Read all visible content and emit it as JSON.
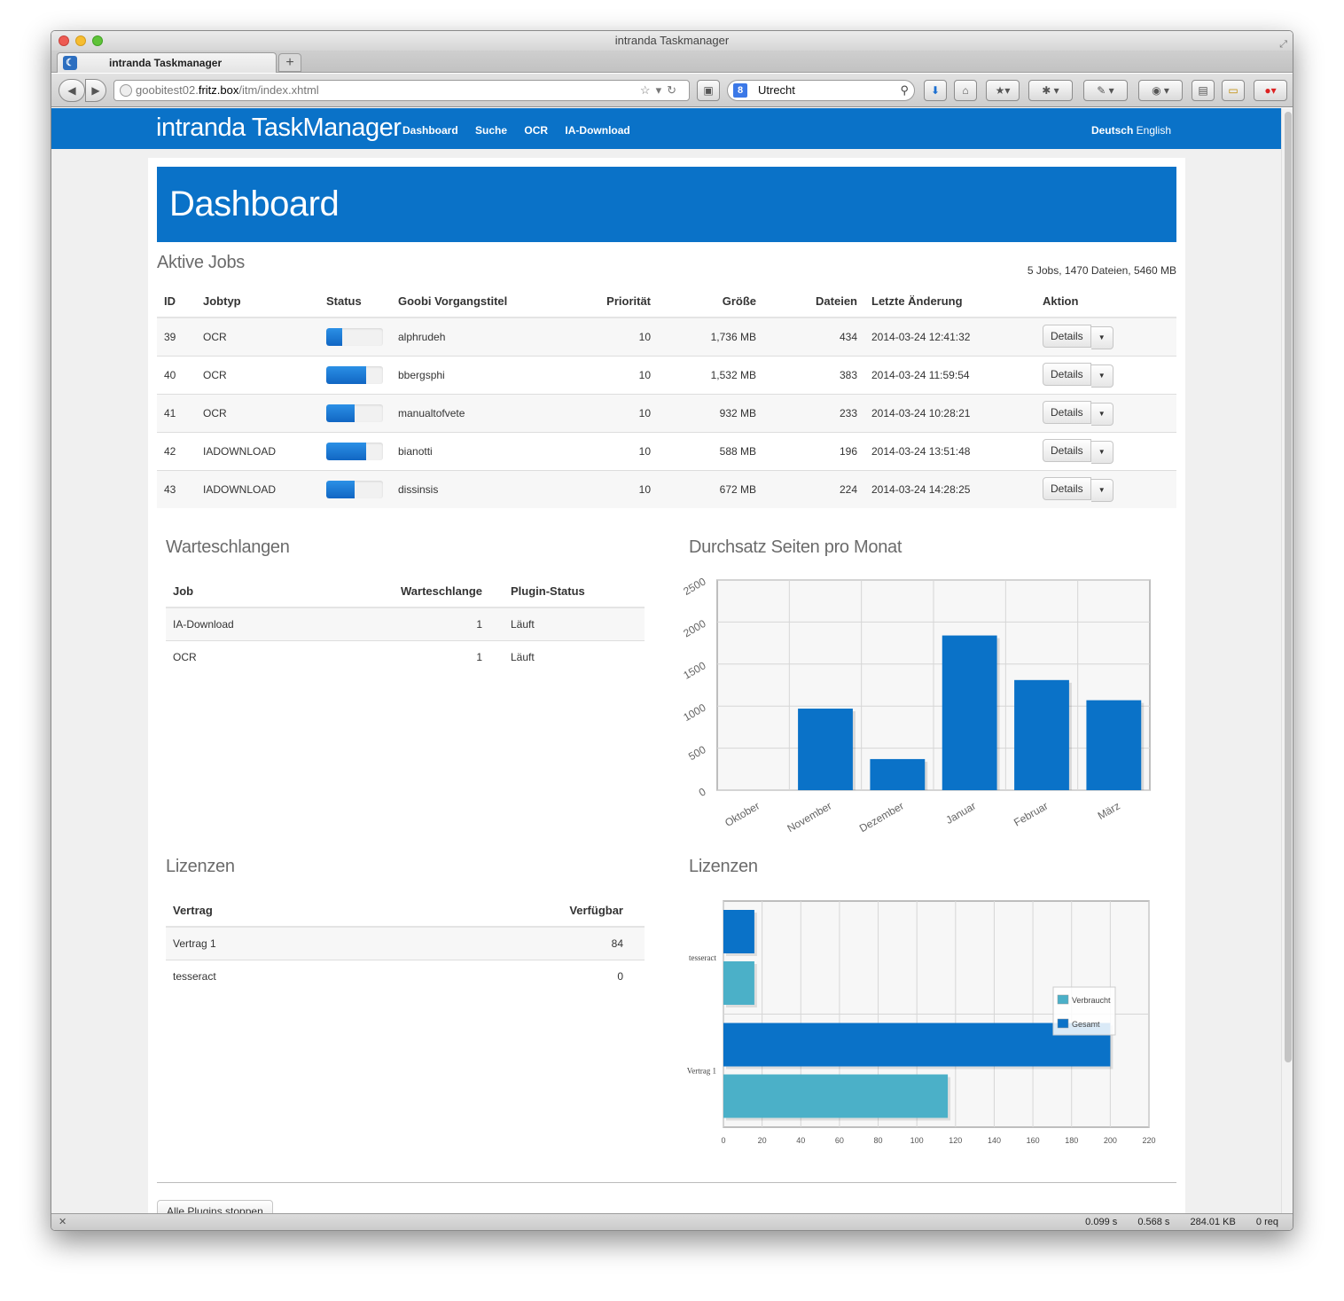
{
  "browser": {
    "window_title": "intranda Taskmanager",
    "tab_title": "intranda Taskmanager",
    "url_prefix": "goobitest02.",
    "url_host": "fritz.box",
    "url_path": "/itm/index.xhtml",
    "search_query": "Utrecht",
    "status": [
      "0.099 s",
      "0.568 s",
      "284.01 KB",
      "0 req"
    ]
  },
  "app": {
    "brand": "intranda TaskManager",
    "menu": [
      "Dashboard",
      "Suche",
      "OCR",
      "IA-Download"
    ],
    "lang_active": "Deutsch",
    "lang_other": "English",
    "page_title": "Dashboard"
  },
  "jobs": {
    "title": "Aktive Jobs",
    "summary": "5 Jobs, 1470 Dateien, 5460 MB",
    "headers": [
      "ID",
      "Jobtyp",
      "Status",
      "Goobi Vorgangstitel",
      "Priorität",
      "Größe",
      "Dateien",
      "Letzte Änderung",
      "Aktion"
    ],
    "button_label": "Details",
    "rows": [
      {
        "id": "39",
        "type": "OCR",
        "progress": 0.28,
        "title": "alphrudeh",
        "priority": "10",
        "size": "1,736 MB",
        "files": "434",
        "changed": "2014-03-24 12:41:32"
      },
      {
        "id": "40",
        "type": "OCR",
        "progress": 0.7,
        "title": "bbergsphi",
        "priority": "10",
        "size": "1,532 MB",
        "files": "383",
        "changed": "2014-03-24 11:59:54"
      },
      {
        "id": "41",
        "type": "OCR",
        "progress": 0.5,
        "title": "manualtofvete",
        "priority": "10",
        "size": "932 MB",
        "files": "233",
        "changed": "2014-03-24 10:28:21"
      },
      {
        "id": "42",
        "type": "IADOWNLOAD",
        "progress": 0.7,
        "title": "bianotti",
        "priority": "10",
        "size": "588 MB",
        "files": "196",
        "changed": "2014-03-24 13:51:48"
      },
      {
        "id": "43",
        "type": "IADOWNLOAD",
        "progress": 0.5,
        "title": "dissinsis",
        "priority": "10",
        "size": "672 MB",
        "files": "224",
        "changed": "2014-03-24 14:28:25"
      }
    ]
  },
  "queues": {
    "title": "Warteschlangen",
    "headers": [
      "Job",
      "Warteschlange",
      "Plugin-Status"
    ],
    "rows": [
      {
        "job": "IA-Download",
        "queue": "1",
        "status": "Läuft"
      },
      {
        "job": "OCR",
        "queue": "1",
        "status": "Läuft"
      }
    ]
  },
  "licenses": {
    "title": "Lizenzen",
    "headers": [
      "Vertrag",
      "Verfügbar"
    ],
    "rows": [
      {
        "contract": "Vertrag 1",
        "available": "84"
      },
      {
        "contract": "tesseract",
        "available": "0"
      }
    ]
  },
  "footer": {
    "stop_button": "Alle Plugins stoppen"
  },
  "chart_data": [
    {
      "type": "bar",
      "title": "Durchsatz Seiten pro Monat",
      "categories": [
        "Oktober",
        "November",
        "Dezember",
        "Januar",
        "Februar",
        "März"
      ],
      "values": [
        0,
        970,
        370,
        1840,
        1310,
        1070
      ],
      "ylim": [
        0,
        2500
      ],
      "yticks": [
        0,
        500,
        1000,
        1500,
        2000,
        2500
      ],
      "color": "#0a72c8",
      "grid": true
    },
    {
      "type": "bar",
      "orientation": "horizontal",
      "title": "Lizenzen",
      "categories": [
        "tesseract",
        "Vertrag 1"
      ],
      "series": [
        {
          "name": "Gesamt",
          "color": "#0a72c8",
          "values": [
            16,
            200
          ]
        },
        {
          "name": "Verbraucht",
          "color": "#4bb0c8",
          "values": [
            16,
            116
          ]
        }
      ],
      "xlim": [
        0,
        220
      ],
      "xticks": [
        0,
        20,
        40,
        60,
        80,
        100,
        120,
        140,
        160,
        180,
        200,
        220
      ],
      "legend": "right",
      "grid": true
    }
  ]
}
